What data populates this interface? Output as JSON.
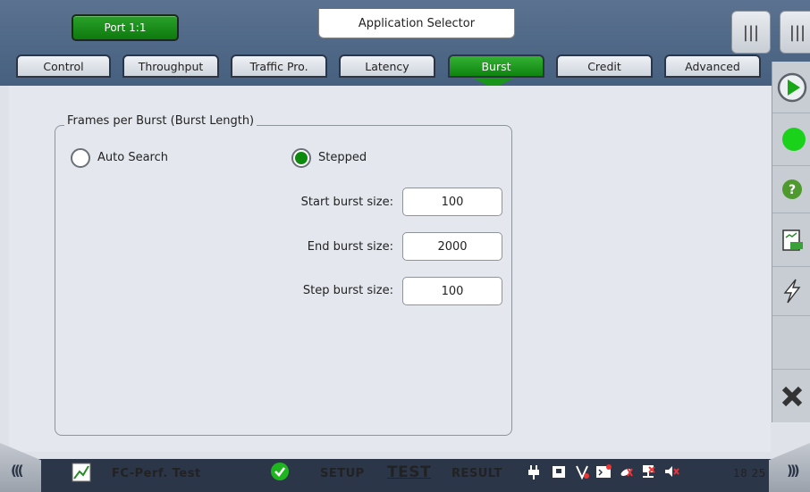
{
  "header": {
    "port_label": "Port 1:1",
    "app_selector_label": "Application Selector",
    "handle_label": "|||"
  },
  "tabs": [
    {
      "label": "Control",
      "active": false
    },
    {
      "label": "Throughput",
      "active": false
    },
    {
      "label": "Traffic Pro.",
      "active": false
    },
    {
      "label": "Latency",
      "active": false
    },
    {
      "label": "Burst",
      "active": true
    },
    {
      "label": "Credit",
      "active": false
    },
    {
      "label": "Advanced",
      "active": false
    }
  ],
  "burst": {
    "group_title": "Frames per Burst (Burst Length)",
    "mode_auto_label": "Auto Search",
    "mode_stepped_label": "Stepped",
    "selected_mode": "Stepped",
    "start_label": "Start burst size:",
    "start_value": "100",
    "end_label": "End burst size:",
    "end_value": "2000",
    "step_label": "Step burst size:",
    "step_value": "100"
  },
  "right_panel": {
    "buttons": [
      "play-icon",
      "status-led-icon",
      "help-icon",
      "report-icon",
      "lightning-icon",
      "close-icon"
    ],
    "status_color": "#19d219"
  },
  "bottom": {
    "left_chevron": "(((",
    "right_chevron": ")))",
    "test_name": "FC-Perf. Test",
    "setup_label": "SETUP",
    "test_label": "TEST",
    "result_label": "RESULT",
    "time": "18 25"
  },
  "colors": {
    "accent_green": "#0f840f",
    "header_blue": "#46607f",
    "bottom_bar": "#2c3649"
  }
}
